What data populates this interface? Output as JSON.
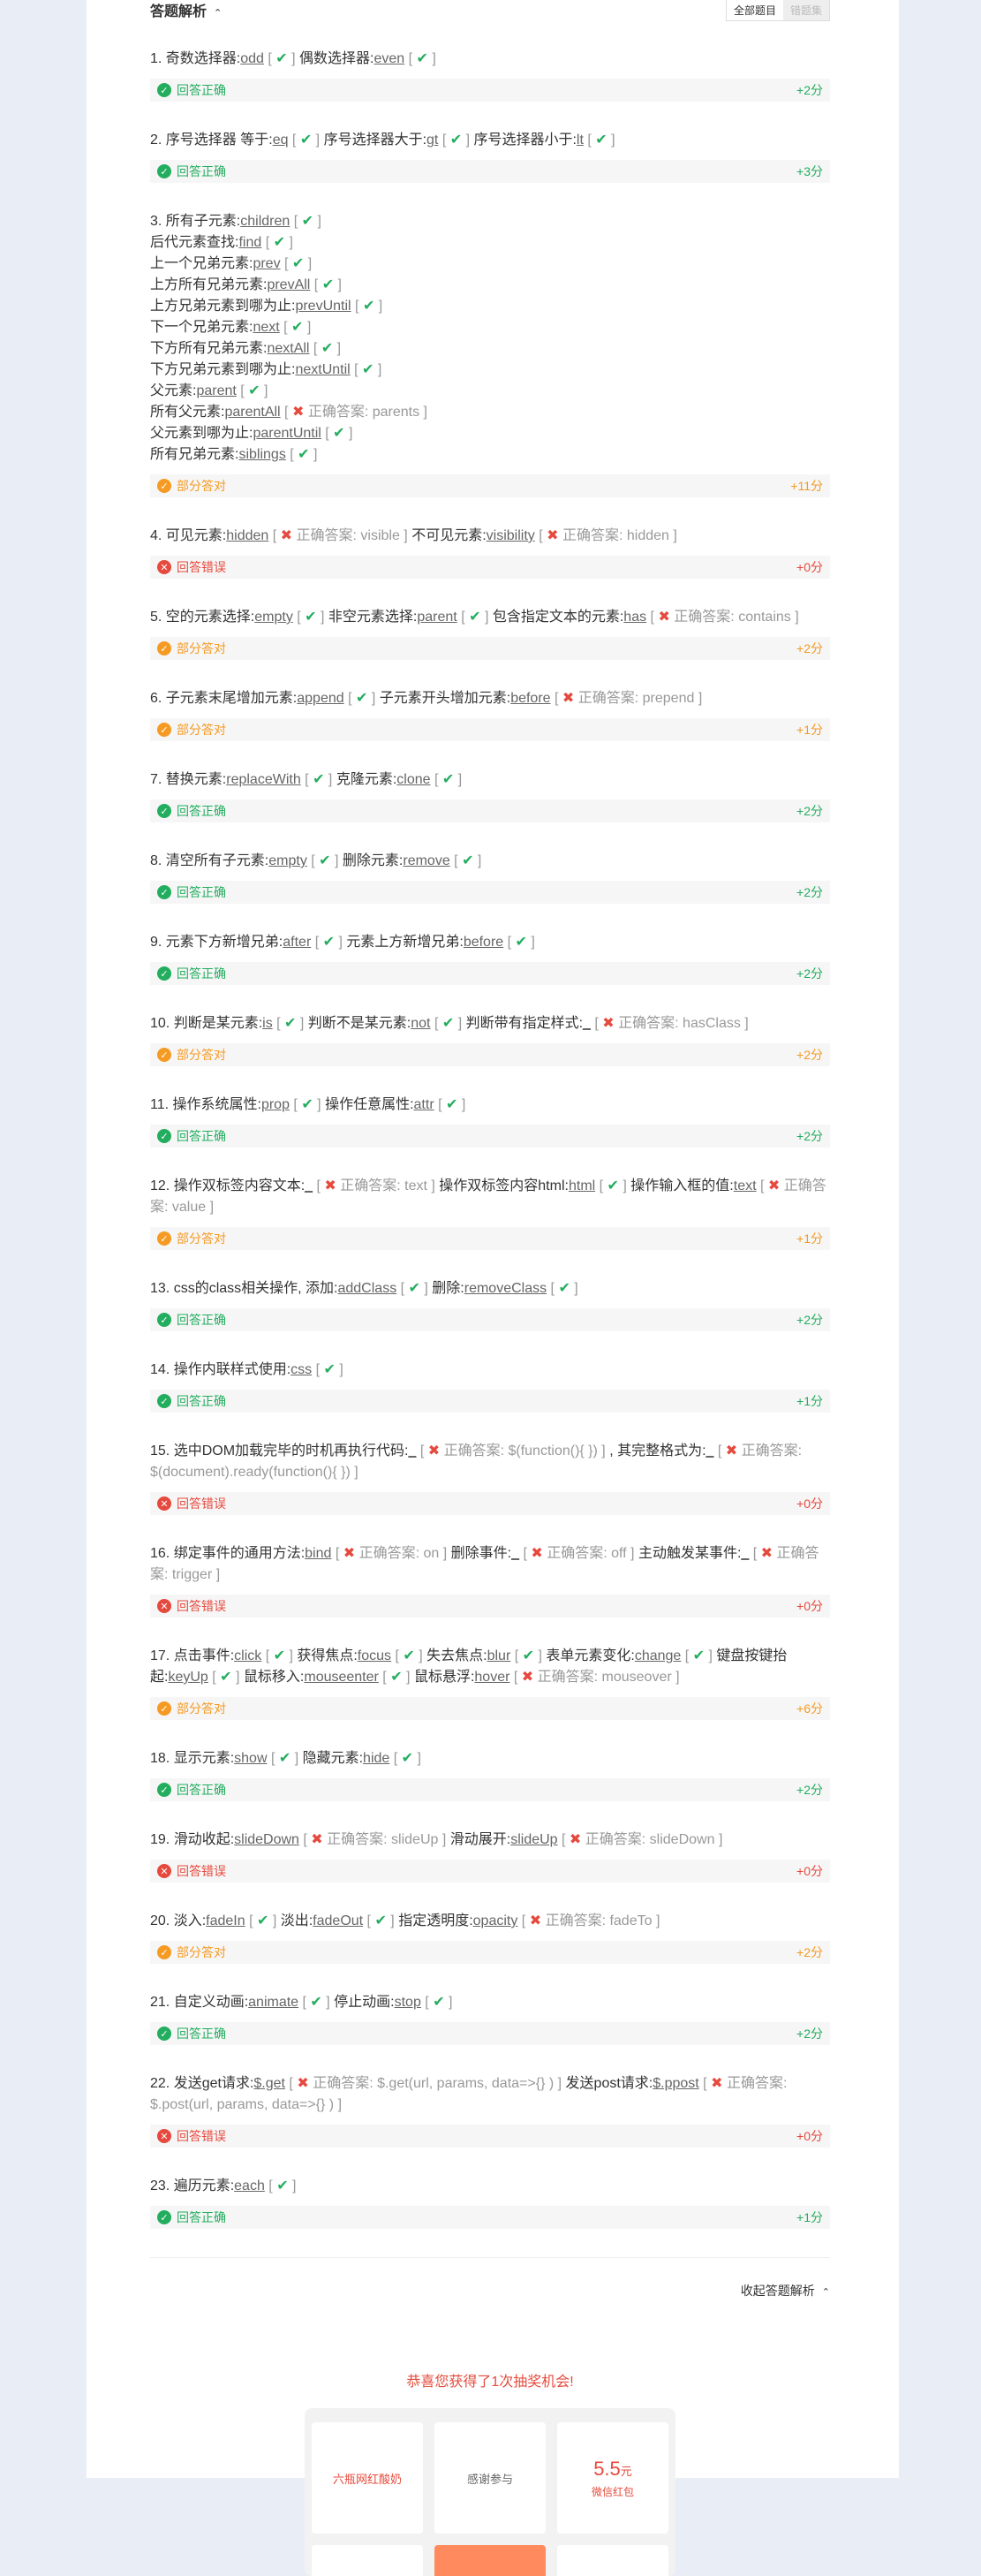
{
  "header": {
    "title": "答题解析",
    "toggle_all": "全部题目",
    "toggle_wrong": "错题集"
  },
  "collapse_label": "收起答题解析",
  "lottery": {
    "title": "恭喜您获得了1次抽奖机会!",
    "items": [
      "六瓶网红酸奶",
      "感谢参与"
    ],
    "money_value": "5.5",
    "money_unit": "元",
    "money_caption": "微信红包"
  },
  "colors": {
    "correct": "#23ad5f",
    "partial": "#f59a23",
    "wrong": "#e6493e"
  },
  "status_labels": {
    "correct": "回答正确",
    "partial": "部分答对",
    "wrong": "回答错误"
  },
  "questions": [
    {
      "status": "correct",
      "score": "+2分",
      "lines": [
        [
          [
            "t",
            "1. 奇数选择器:"
          ],
          [
            "a",
            "odd"
          ],
          [
            "ok"
          ],
          [
            "t",
            "  偶数选择器:"
          ],
          [
            "a",
            "even"
          ],
          [
            "ok"
          ]
        ]
      ]
    },
    {
      "status": "correct",
      "score": "+3分",
      "lines": [
        [
          [
            "t",
            "2. 序号选择器 等于:"
          ],
          [
            "a",
            "eq"
          ],
          [
            "ok"
          ],
          [
            "t",
            "序号选择器大于:"
          ],
          [
            "a",
            "gt"
          ],
          [
            "ok"
          ],
          [
            "t",
            "序号选择器小于:"
          ],
          [
            "a",
            "lt"
          ],
          [
            "ok"
          ]
        ]
      ]
    },
    {
      "status": "partial",
      "score": "+11分",
      "lines": [
        [
          [
            "t",
            "3. 所有子元素:"
          ],
          [
            "a",
            "children"
          ],
          [
            "ok"
          ]
        ],
        [
          [
            "t",
            "后代元素查找:"
          ],
          [
            "a",
            "find"
          ],
          [
            "ok"
          ]
        ],
        [
          [
            "t",
            "上一个兄弟元素:"
          ],
          [
            "a",
            "prev"
          ],
          [
            "ok"
          ]
        ],
        [
          [
            "t",
            "上方所有兄弟元素:"
          ],
          [
            "a",
            "prevAll"
          ],
          [
            "ok"
          ]
        ],
        [
          [
            "t",
            "上方兄弟元素到哪为止:"
          ],
          [
            "a",
            "prevUntil"
          ],
          [
            "ok"
          ]
        ],
        [
          [
            "t",
            "下一个兄弟元素:"
          ],
          [
            "a",
            "next"
          ],
          [
            "ok"
          ]
        ],
        [
          [
            "t",
            "下方所有兄弟元素:"
          ],
          [
            "a",
            "nextAll"
          ],
          [
            "ok"
          ]
        ],
        [
          [
            "t",
            "下方兄弟元素到哪为止:"
          ],
          [
            "a",
            "nextUntil"
          ],
          [
            "ok"
          ]
        ],
        [
          [
            "t",
            "父元素:"
          ],
          [
            "a",
            "parent"
          ],
          [
            "ok"
          ]
        ],
        [
          [
            "t",
            "所有父元素:"
          ],
          [
            "a",
            "parentAll"
          ],
          [
            "x",
            "正确答案: parents"
          ]
        ],
        [
          [
            "t",
            "父元素到哪为止:"
          ],
          [
            "a",
            "parentUntil"
          ],
          [
            "ok"
          ]
        ],
        [
          [
            "t",
            "所有兄弟元素:"
          ],
          [
            "a",
            "siblings"
          ],
          [
            "ok"
          ]
        ]
      ]
    },
    {
      "status": "wrong",
      "score": "+0分",
      "lines": [
        [
          [
            "t",
            "4. 可见元素:"
          ],
          [
            "a",
            "hidden"
          ],
          [
            "x",
            "正确答案: visible"
          ],
          [
            "t",
            "  不可见元素:"
          ],
          [
            "a",
            "visibility"
          ],
          [
            "x",
            "正确答案: hidden"
          ]
        ]
      ]
    },
    {
      "status": "partial",
      "score": "+2分",
      "lines": [
        [
          [
            "t",
            "5. 空的元素选择:"
          ],
          [
            "a",
            "empty"
          ],
          [
            "ok"
          ],
          [
            "t",
            "非空元素选择:"
          ],
          [
            "a",
            "parent"
          ],
          [
            "ok"
          ],
          [
            "t",
            "包含指定文本的元素:"
          ],
          [
            "a",
            "has"
          ],
          [
            "x",
            "正确答案: contains"
          ]
        ]
      ]
    },
    {
      "status": "partial",
      "score": "+1分",
      "lines": [
        [
          [
            "t",
            "6. 子元素末尾增加元素:"
          ],
          [
            "a",
            "append"
          ],
          [
            "ok"
          ],
          [
            "t",
            "子元素开头增加元素:"
          ],
          [
            "a",
            "before"
          ],
          [
            "x",
            "正确答案: prepend"
          ]
        ]
      ]
    },
    {
      "status": "correct",
      "score": "+2分",
      "lines": [
        [
          [
            "t",
            "7. 替换元素:"
          ],
          [
            "a",
            "replaceWith"
          ],
          [
            "ok"
          ],
          [
            "t",
            "克隆元素:"
          ],
          [
            "a",
            "clone"
          ],
          [
            "ok"
          ]
        ]
      ]
    },
    {
      "status": "correct",
      "score": "+2分",
      "lines": [
        [
          [
            "t",
            "8. 清空所有子元素:"
          ],
          [
            "a",
            "empty"
          ],
          [
            "ok"
          ],
          [
            "t",
            "删除元素:"
          ],
          [
            "a",
            "remove"
          ],
          [
            "ok"
          ]
        ]
      ]
    },
    {
      "status": "correct",
      "score": "+2分",
      "lines": [
        [
          [
            "t",
            "9. 元素下方新增兄弟:"
          ],
          [
            "a",
            "after"
          ],
          [
            "ok"
          ],
          [
            "t",
            "元素上方新增兄弟:"
          ],
          [
            "a",
            "before"
          ],
          [
            "ok"
          ]
        ]
      ]
    },
    {
      "status": "partial",
      "score": "+2分",
      "lines": [
        [
          [
            "t",
            "10. 判断是某元素:"
          ],
          [
            "a",
            "is"
          ],
          [
            "ok"
          ],
          [
            "t",
            "判断不是某元素:"
          ],
          [
            "a",
            "not"
          ],
          [
            "ok"
          ],
          [
            "t",
            "判断带有指定样式:"
          ],
          [
            "a",
            "_"
          ],
          [
            "x",
            "正确答案: hasClass"
          ]
        ]
      ]
    },
    {
      "status": "correct",
      "score": "+2分",
      "lines": [
        [
          [
            "t",
            "11. 操作系统属性:"
          ],
          [
            "a",
            "prop"
          ],
          [
            "ok"
          ],
          [
            "t",
            "操作任意属性:"
          ],
          [
            "a",
            "attr"
          ],
          [
            "ok"
          ]
        ]
      ]
    },
    {
      "status": "partial",
      "score": "+1分",
      "lines": [
        [
          [
            "t",
            "12. 操作双标签内容文本:"
          ],
          [
            "a",
            "_"
          ],
          [
            "x",
            "正确答案: text"
          ],
          [
            "t",
            "操作双标签内容html:"
          ],
          [
            "a",
            "html"
          ],
          [
            "ok"
          ],
          [
            "t",
            "  操作输入框的值:"
          ],
          [
            "a",
            "text"
          ],
          [
            "x",
            "正确答案: value"
          ]
        ]
      ]
    },
    {
      "status": "correct",
      "score": "+2分",
      "lines": [
        [
          [
            "t",
            "13. css的class相关操作, 添加:"
          ],
          [
            "a",
            "addClass"
          ],
          [
            "ok"
          ],
          [
            "t",
            "删除:"
          ],
          [
            "a",
            "removeClass"
          ],
          [
            "ok"
          ]
        ]
      ]
    },
    {
      "status": "correct",
      "score": "+1分",
      "lines": [
        [
          [
            "t",
            "14. 操作内联样式使用:"
          ],
          [
            "a",
            "css"
          ],
          [
            "ok"
          ]
        ]
      ]
    },
    {
      "status": "wrong",
      "score": "+0分",
      "lines": [
        [
          [
            "t",
            "15. 选中DOM加载完毕的时机再执行代码:"
          ],
          [
            "a",
            "_"
          ],
          [
            "x",
            "正确答案: $(function(){ })"
          ],
          [
            "t",
            ", 其完整格式为:"
          ],
          [
            "a",
            "_"
          ],
          [
            "x",
            "正确答案: $(document).ready(function(){ })"
          ]
        ]
      ]
    },
    {
      "status": "wrong",
      "score": "+0分",
      "lines": [
        [
          [
            "t",
            "16. 绑定事件的通用方法:"
          ],
          [
            "a",
            "bind"
          ],
          [
            "x",
            "正确答案: on"
          ],
          [
            "t",
            "删除事件:"
          ],
          [
            "a",
            "_"
          ],
          [
            "x",
            "正确答案: off"
          ],
          [
            "t",
            "  主动触发某事件:"
          ],
          [
            "a",
            "_"
          ],
          [
            "x",
            "正确答案: trigger"
          ]
        ]
      ]
    },
    {
      "status": "partial",
      "score": "+6分",
      "lines": [
        [
          [
            "t",
            "17. 点击事件:"
          ],
          [
            "a",
            "click"
          ],
          [
            "ok"
          ],
          [
            "t",
            "获得焦点:"
          ],
          [
            "a",
            "focus"
          ],
          [
            "ok"
          ],
          [
            "t",
            "失去焦点:"
          ],
          [
            "a",
            "blur"
          ],
          [
            "ok"
          ],
          [
            "t",
            "  表单元素变化:"
          ],
          [
            "a",
            "change"
          ],
          [
            "ok"
          ],
          [
            "t",
            "键盘按键抬起:"
          ],
          [
            "a",
            "keyUp"
          ],
          [
            "ok"
          ],
          [
            "t",
            "  鼠标移入:"
          ],
          [
            "a",
            "mouseenter"
          ],
          [
            "ok"
          ],
          [
            "t",
            "  鼠标悬浮:"
          ],
          [
            "a",
            "hover"
          ],
          [
            "x",
            "正确答案: mouseover"
          ]
        ]
      ]
    },
    {
      "status": "correct",
      "score": "+2分",
      "lines": [
        [
          [
            "t",
            "18. 显示元素:"
          ],
          [
            "a",
            "show"
          ],
          [
            "ok"
          ],
          [
            "t",
            "隐藏元素:"
          ],
          [
            "a",
            "hide"
          ],
          [
            "ok"
          ]
        ]
      ]
    },
    {
      "status": "wrong",
      "score": "+0分",
      "lines": [
        [
          [
            "t",
            "19. 滑动收起:"
          ],
          [
            "a",
            "slideDown"
          ],
          [
            "x",
            "正确答案: slideUp"
          ],
          [
            "t",
            "滑动展开:"
          ],
          [
            "a",
            "slideUp"
          ],
          [
            "x",
            "正确答案: slideDown"
          ]
        ]
      ]
    },
    {
      "status": "partial",
      "score": "+2分",
      "lines": [
        [
          [
            "t",
            "20. 淡入:"
          ],
          [
            "a",
            "fadeIn"
          ],
          [
            "ok"
          ],
          [
            "t",
            "淡出:"
          ],
          [
            "a",
            "fadeOut"
          ],
          [
            "ok"
          ],
          [
            "t",
            "  指定透明度:"
          ],
          [
            "a",
            "opacity"
          ],
          [
            "x",
            "正确答案: fadeTo"
          ]
        ]
      ]
    },
    {
      "status": "correct",
      "score": "+2分",
      "lines": [
        [
          [
            "t",
            "21. 自定义动画:"
          ],
          [
            "a",
            "animate"
          ],
          [
            "ok"
          ],
          [
            "t",
            "停止动画:"
          ],
          [
            "a",
            "stop"
          ],
          [
            "ok"
          ]
        ]
      ]
    },
    {
      "status": "wrong",
      "score": "+0分",
      "lines": [
        [
          [
            "t",
            "22. 发送get请求:"
          ],
          [
            "a",
            "$.get"
          ],
          [
            "x",
            "正确答案: $.get(url, params, data=>{} )"
          ],
          [
            "t",
            "  发送post请求:"
          ],
          [
            "a",
            "$.ppost"
          ],
          [
            "x",
            "正确答案: $.post(url, params, data=>{} )"
          ]
        ]
      ]
    },
    {
      "status": "correct",
      "score": "+1分",
      "lines": [
        [
          [
            "t",
            "23. 遍历元素:"
          ],
          [
            "a",
            "each"
          ],
          [
            "ok"
          ]
        ]
      ]
    }
  ]
}
